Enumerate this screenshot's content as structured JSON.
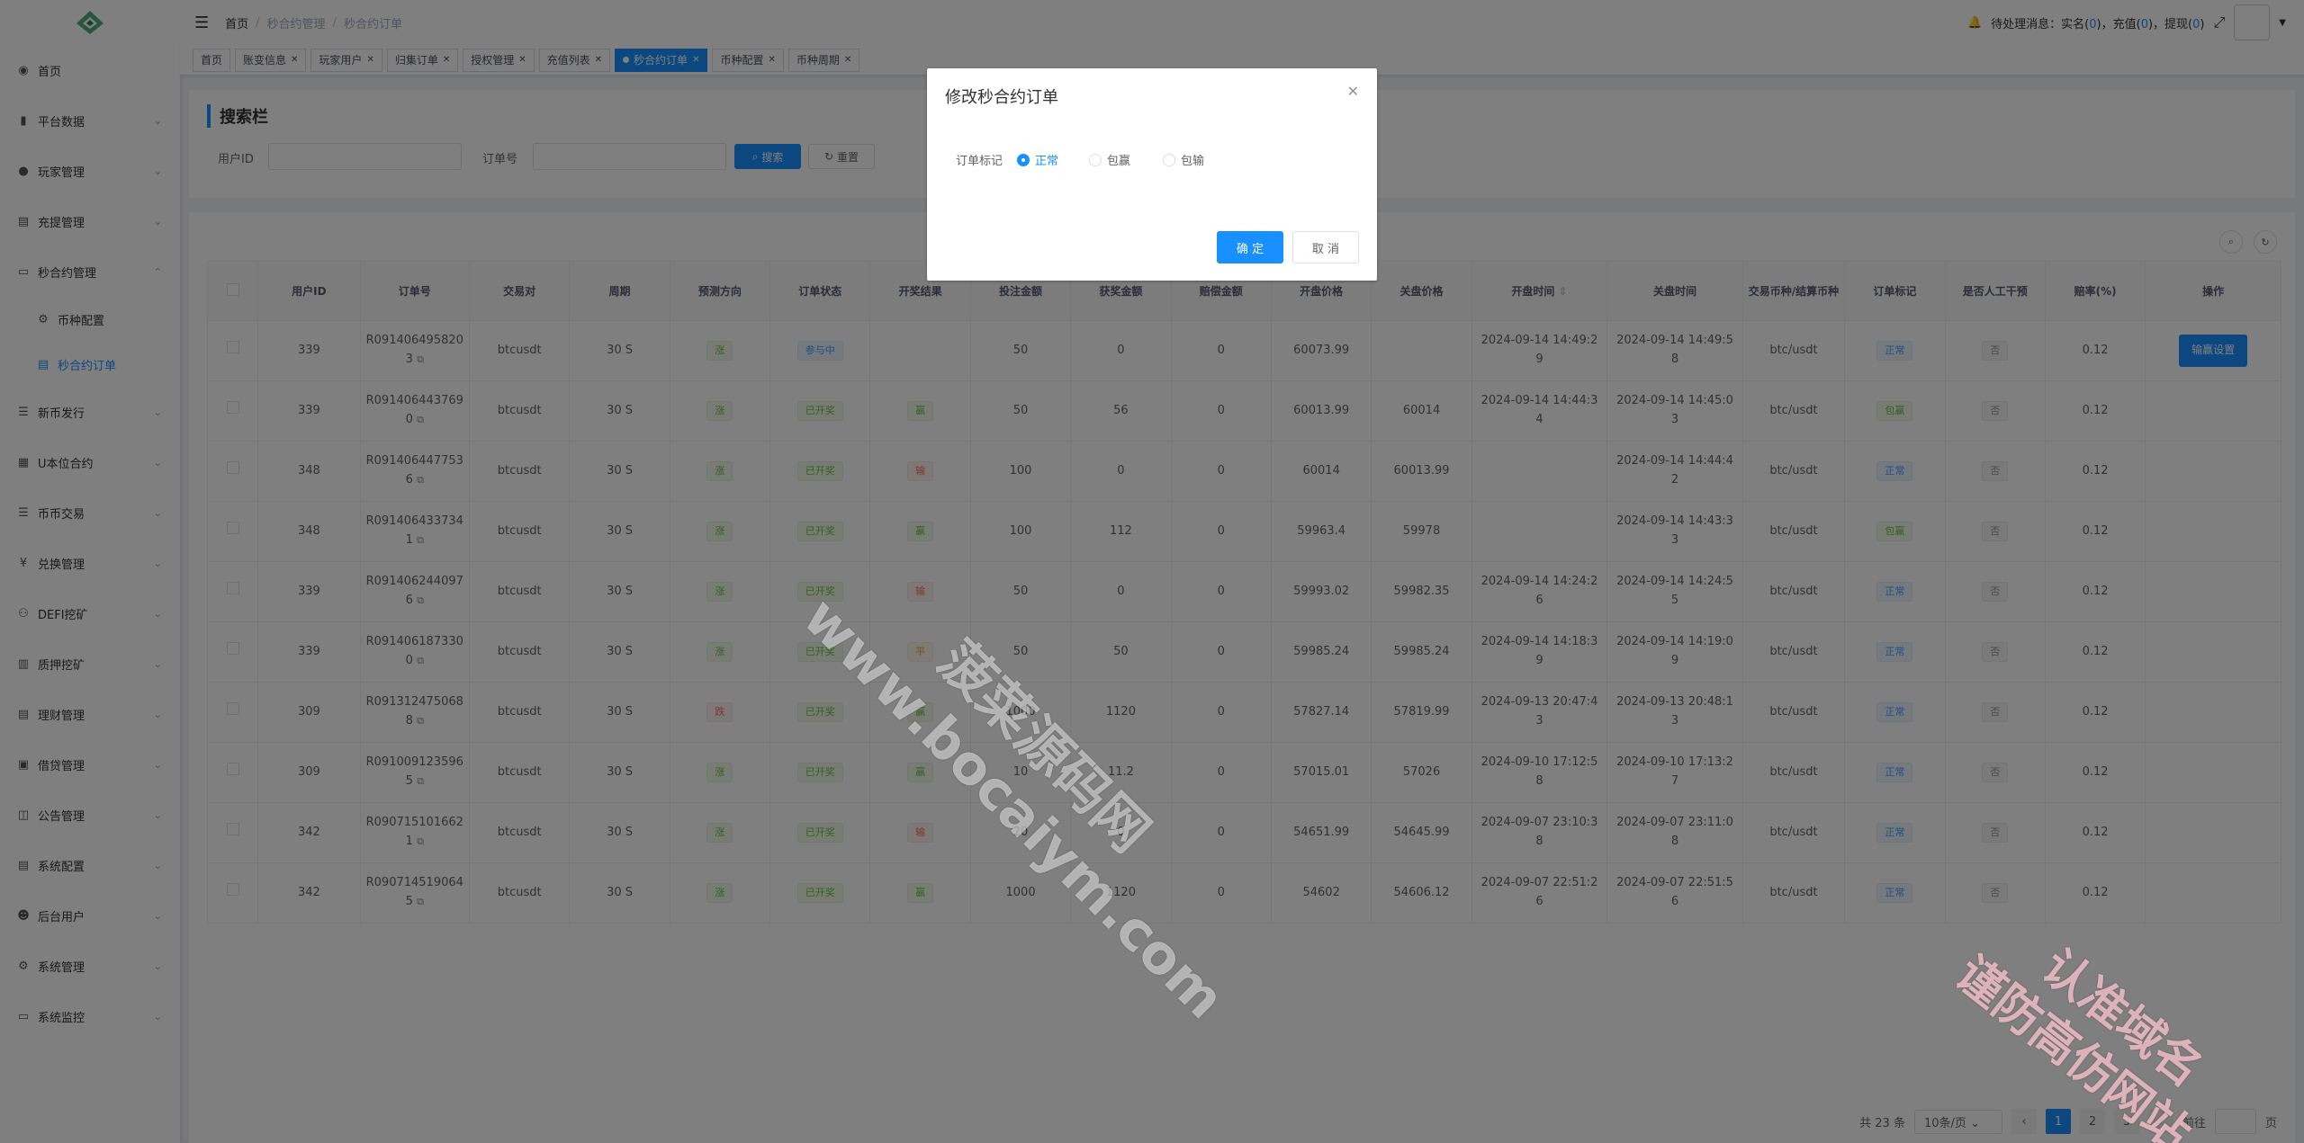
{
  "sidebar": {
    "items": [
      {
        "label": "首页",
        "icon": "dashboard-icon"
      },
      {
        "label": "平台数据",
        "icon": "chart-icon"
      },
      {
        "label": "玩家管理",
        "icon": "user-icon"
      },
      {
        "label": "充提管理",
        "icon": "wallet-icon"
      },
      {
        "label": "秒合约管理",
        "icon": "monitor-icon"
      },
      {
        "label": "币种配置",
        "icon": "gear-icon",
        "sub": true
      },
      {
        "label": "秒合约订单",
        "icon": "document-icon",
        "sub": true,
        "active": true
      },
      {
        "label": "新币发行",
        "icon": "list-icon"
      },
      {
        "label": "U本位合约",
        "icon": "grid-icon"
      },
      {
        "label": "币币交易",
        "icon": "list-icon"
      },
      {
        "label": "兑换管理",
        "icon": "yen-icon"
      },
      {
        "label": "DEFI挖矿",
        "icon": "people-icon"
      },
      {
        "label": "质押挖矿",
        "icon": "bar-chart-icon"
      },
      {
        "label": "理财管理",
        "icon": "document-icon"
      },
      {
        "label": "借贷管理",
        "icon": "card-icon"
      },
      {
        "label": "公告管理",
        "icon": "book-icon"
      },
      {
        "label": "系统配置",
        "icon": "document-icon"
      },
      {
        "label": "后台用户",
        "icon": "admin-icon"
      },
      {
        "label": "系统管理",
        "icon": "gear-icon"
      },
      {
        "label": "系统监控",
        "icon": "monitor-icon"
      }
    ]
  },
  "navbar": {
    "breadcrumb": [
      "首页",
      "秒合约管理",
      "秒合约订单"
    ],
    "pending_prefix": "待处理消息：实名(",
    "real_name": "0",
    "charge_label": ")，充值(",
    "charge": "0",
    "withdraw_label": ")，提现(",
    "withdraw": "0",
    "suffix": ")"
  },
  "tags": [
    "首页",
    "账变信息",
    "玩家用户",
    "归集订单",
    "授权管理",
    "充值列表",
    "秒合约订单",
    "币种配置",
    "币种周期"
  ],
  "search": {
    "title": "搜索栏",
    "user_id_label": "用户ID",
    "order_no_label": "订单号",
    "search_btn": "搜索",
    "reset_btn": "重置"
  },
  "table": {
    "headers": [
      "用户ID",
      "订单号",
      "交易对",
      "周期",
      "预测方向",
      "订单状态",
      "开奖结果",
      "投注金额",
      "获奖金额",
      "赔偿金额",
      "开盘价格",
      "关盘价格",
      "开盘时间",
      "关盘时间",
      "交易币种/结算币种",
      "订单标记",
      "是否人工干预",
      "赔率(%)",
      "操作"
    ],
    "rows": [
      {
        "uid": "339",
        "order": "R0914064958203",
        "pair": "btcusdt",
        "period": "30 S",
        "dir": "涨",
        "dir_c": "green",
        "status": "参与中",
        "status_c": "blue",
        "result": "",
        "result_c": "",
        "bet": "50",
        "win": "0",
        "comp": "0",
        "open": "60073.99",
        "close": "",
        "otime": "2024-09-14 14:49:29",
        "ctime": "2024-09-14 14:49:58",
        "coin": "btc/usdt",
        "mark": "正常",
        "mark_c": "blue",
        "manual": "否",
        "rate": "0.12",
        "op": "输赢设置"
      },
      {
        "uid": "339",
        "order": "R0914064437690",
        "pair": "btcusdt",
        "period": "30 S",
        "dir": "涨",
        "dir_c": "green",
        "status": "已开奖",
        "status_c": "green",
        "result": "赢",
        "result_c": "green",
        "bet": "50",
        "win": "56",
        "comp": "0",
        "open": "60013.99",
        "close": "60014",
        "otime": "2024-09-14 14:44:34",
        "ctime": "2024-09-14 14:45:03",
        "coin": "btc/usdt",
        "mark": "包赢",
        "mark_c": "green",
        "manual": "否",
        "rate": "0.12",
        "op": ""
      },
      {
        "uid": "348",
        "order": "R0914064477536",
        "pair": "btcusdt",
        "period": "30 S",
        "dir": "涨",
        "dir_c": "green",
        "status": "已开奖",
        "status_c": "green",
        "result": "输",
        "result_c": "red",
        "bet": "100",
        "win": "0",
        "comp": "0",
        "open": "60014",
        "close": "60013.99",
        "otime": "",
        "ctime": "2024-09-14 14:44:42",
        "coin": "btc/usdt",
        "mark": "正常",
        "mark_c": "blue",
        "manual": "否",
        "rate": "0.12",
        "op": ""
      },
      {
        "uid": "348",
        "order": "R0914064337341",
        "pair": "btcusdt",
        "period": "30 S",
        "dir": "涨",
        "dir_c": "green",
        "status": "已开奖",
        "status_c": "green",
        "result": "赢",
        "result_c": "green",
        "bet": "100",
        "win": "112",
        "comp": "0",
        "open": "59963.4",
        "close": "59978",
        "otime": "",
        "ctime": "2024-09-14 14:43:33",
        "coin": "btc/usdt",
        "mark": "包赢",
        "mark_c": "green",
        "manual": "否",
        "rate": "0.12",
        "op": ""
      },
      {
        "uid": "339",
        "order": "R0914062440976",
        "pair": "btcusdt",
        "period": "30 S",
        "dir": "涨",
        "dir_c": "green",
        "status": "已开奖",
        "status_c": "green",
        "result": "输",
        "result_c": "red",
        "bet": "50",
        "win": "0",
        "comp": "0",
        "open": "59993.02",
        "close": "59982.35",
        "otime": "2024-09-14 14:24:26",
        "ctime": "2024-09-14 14:24:55",
        "coin": "btc/usdt",
        "mark": "正常",
        "mark_c": "blue",
        "manual": "否",
        "rate": "0.12",
        "op": ""
      },
      {
        "uid": "339",
        "order": "R0914061873300",
        "pair": "btcusdt",
        "period": "30 S",
        "dir": "涨",
        "dir_c": "green",
        "status": "已开奖",
        "status_c": "green",
        "result": "平",
        "result_c": "orange",
        "bet": "50",
        "win": "50",
        "comp": "0",
        "open": "59985.24",
        "close": "59985.24",
        "otime": "2024-09-14 14:18:39",
        "ctime": "2024-09-14 14:19:09",
        "coin": "btc/usdt",
        "mark": "正常",
        "mark_c": "blue",
        "manual": "否",
        "rate": "0.12",
        "op": ""
      },
      {
        "uid": "309",
        "order": "R0913124750688",
        "pair": "btcusdt",
        "period": "30 S",
        "dir": "跌",
        "dir_c": "red",
        "status": "已开奖",
        "status_c": "green",
        "result": "赢",
        "result_c": "green",
        "bet": "1000",
        "win": "1120",
        "comp": "0",
        "open": "57827.14",
        "close": "57819.99",
        "otime": "2024-09-13 20:47:43",
        "ctime": "2024-09-13 20:48:13",
        "coin": "btc/usdt",
        "mark": "正常",
        "mark_c": "blue",
        "manual": "否",
        "rate": "0.12",
        "op": ""
      },
      {
        "uid": "309",
        "order": "R0910091235965",
        "pair": "btcusdt",
        "period": "30 S",
        "dir": "涨",
        "dir_c": "green",
        "status": "已开奖",
        "status_c": "green",
        "result": "赢",
        "result_c": "green",
        "bet": "10",
        "win": "11.2",
        "comp": "0",
        "open": "57015.01",
        "close": "57026",
        "otime": "2024-09-10 17:12:58",
        "ctime": "2024-09-10 17:13:27",
        "coin": "btc/usdt",
        "mark": "正常",
        "mark_c": "blue",
        "manual": "否",
        "rate": "0.12",
        "op": ""
      },
      {
        "uid": "342",
        "order": "R0907151016621",
        "pair": "btcusdt",
        "period": "30 S",
        "dir": "涨",
        "dir_c": "green",
        "status": "已开奖",
        "status_c": "green",
        "result": "输",
        "result_c": "red",
        "bet": "20",
        "win": "0",
        "comp": "0",
        "open": "54651.99",
        "close": "54645.99",
        "otime": "2024-09-07 23:10:38",
        "ctime": "2024-09-07 23:11:08",
        "coin": "btc/usdt",
        "mark": "正常",
        "mark_c": "blue",
        "manual": "否",
        "rate": "0.12",
        "op": ""
      },
      {
        "uid": "342",
        "order": "R0907145190645",
        "pair": "btcusdt",
        "period": "30 S",
        "dir": "涨",
        "dir_c": "green",
        "status": "已开奖",
        "status_c": "green",
        "result": "赢",
        "result_c": "green",
        "bet": "1000",
        "win": "1120",
        "comp": "0",
        "open": "54602",
        "close": "54606.12",
        "otime": "2024-09-07 22:51:26",
        "ctime": "2024-09-07 22:51:56",
        "coin": "btc/usdt",
        "mark": "正常",
        "mark_c": "blue",
        "manual": "否",
        "rate": "0.12",
        "op": ""
      }
    ]
  },
  "pager": {
    "total": "共 23 条",
    "size": "10条/页",
    "pages": [
      "1",
      "2",
      "3"
    ],
    "current": "1",
    "goto": "前往",
    "page_unit": "页"
  },
  "dialog": {
    "title": "修改秒合约订单",
    "label": "订单标记",
    "options": [
      "正常",
      "包赢",
      "包输"
    ],
    "selected": "正常",
    "ok": "确 定",
    "cancel": "取 消"
  },
  "watermark": {
    "line1": "菠菜源码网",
    "line2": "www.bocaiym.com",
    "line3": "认准域名",
    "line4": "谨防高仿网站"
  },
  "colors": {
    "primary": "#1890ff",
    "green": "#67c23a",
    "red": "#f56c6c",
    "orange": "#e6a23c"
  }
}
